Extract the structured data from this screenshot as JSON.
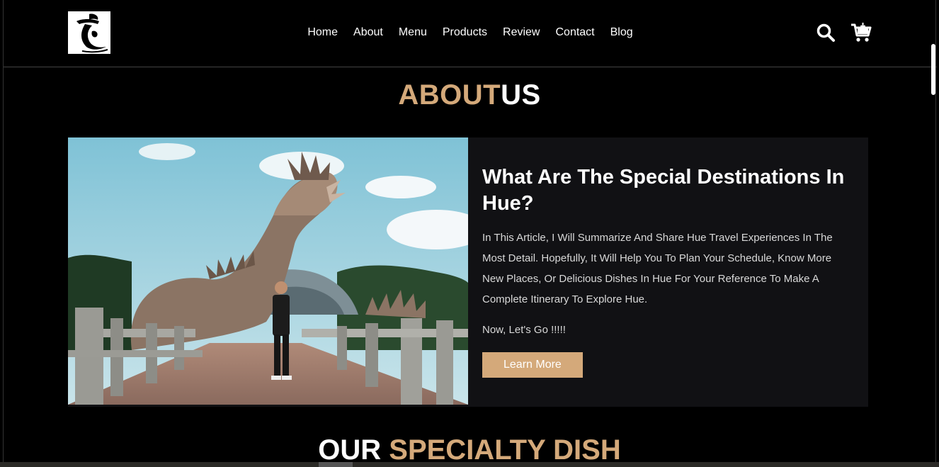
{
  "header": {
    "logo_alt": "logo",
    "nav": [
      "Home",
      "About",
      "Menu",
      "Products",
      "Review",
      "Contact",
      "Blog"
    ]
  },
  "about": {
    "heading_gold": "ABOUT",
    "heading_white": "US",
    "title": "What Are The Special Destinations In Hue?",
    "text": "In This Article, I Will Summarize And Share Hue Travel Experiences In The Most Detail. Hopefully, It Will Help You To Plan Your Schedule, Know More New Places, Or Delicious Dishes In Hue For Your Reference To Make A Complete Itinerary To Explore Hue.",
    "cta_text": "Now, Let's Go !!!!!",
    "button_label": "Learn More"
  },
  "specialty": {
    "heading_white": "OUR",
    "heading_gold": "SPECIALTY DISH"
  },
  "colors": {
    "accent": "#d4a97a",
    "background": "#000000",
    "card": "#111114"
  },
  "icons": [
    "search-icon",
    "cart-icon"
  ]
}
